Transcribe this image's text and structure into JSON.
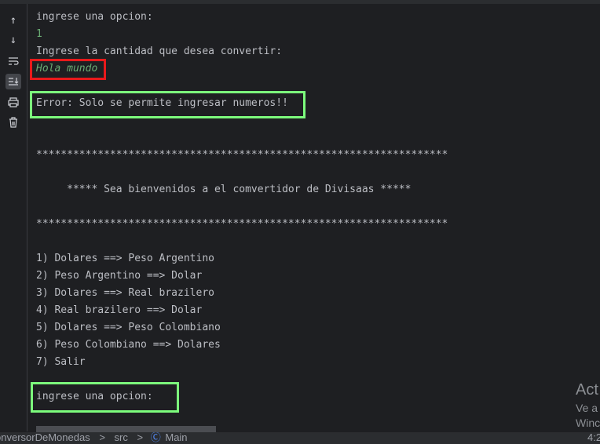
{
  "toolbar": {
    "icons": [
      "arrow-up-icon",
      "arrow-down-icon",
      "soft-wrap-icon",
      "scroll-to-end-icon",
      "print-icon",
      "trash-icon"
    ]
  },
  "console": {
    "lines": [
      {
        "text": "ingrese una opcion:",
        "type": "output"
      },
      {
        "text": "1",
        "type": "input"
      },
      {
        "text": "Ingrese la cantidad que desea convertir:",
        "type": "output"
      },
      {
        "text": "Hola mundo",
        "type": "input"
      },
      {
        "text": "",
        "type": "output"
      },
      {
        "text": "Error: Solo se permite ingresar numeros!!",
        "type": "output"
      },
      {
        "text": "",
        "type": "output"
      },
      {
        "text": "",
        "type": "output"
      },
      {
        "text": "*******************************************************************",
        "type": "output"
      },
      {
        "text": "",
        "type": "output"
      },
      {
        "text": "     ***** Sea bienvenidos a el comvertidor de Divisaas *****",
        "type": "output"
      },
      {
        "text": "",
        "type": "output"
      },
      {
        "text": "*******************************************************************",
        "type": "output"
      },
      {
        "text": "",
        "type": "output"
      },
      {
        "text": "1) Dolares ==> Peso Argentino",
        "type": "output"
      },
      {
        "text": "2) Peso Argentino ==> Dolar",
        "type": "output"
      },
      {
        "text": "3) Dolares ==> Real brazilero",
        "type": "output"
      },
      {
        "text": "4) Real brazilero ==> Dolar",
        "type": "output"
      },
      {
        "text": "5) Dolares ==> Peso Colombiano",
        "type": "output"
      },
      {
        "text": "6) Peso Colombiano ==> Dolares",
        "type": "output"
      },
      {
        "text": "7) Salir",
        "type": "output"
      },
      {
        "text": "",
        "type": "output"
      },
      {
        "text": "ingrese una opcion:",
        "type": "output"
      }
    ]
  },
  "statusbar": {
    "project": "onversorDeMonedas",
    "sep1": ">",
    "folder": "src",
    "sep2": ">",
    "file": "Main",
    "position": "4:2"
  },
  "watermark": {
    "title": "Act",
    "line1": "Ve a",
    "line2": "Winc"
  },
  "colors": {
    "highlight_red": "#e8191b",
    "highlight_green": "#7cfc7c",
    "input_text": "#6aab73"
  }
}
